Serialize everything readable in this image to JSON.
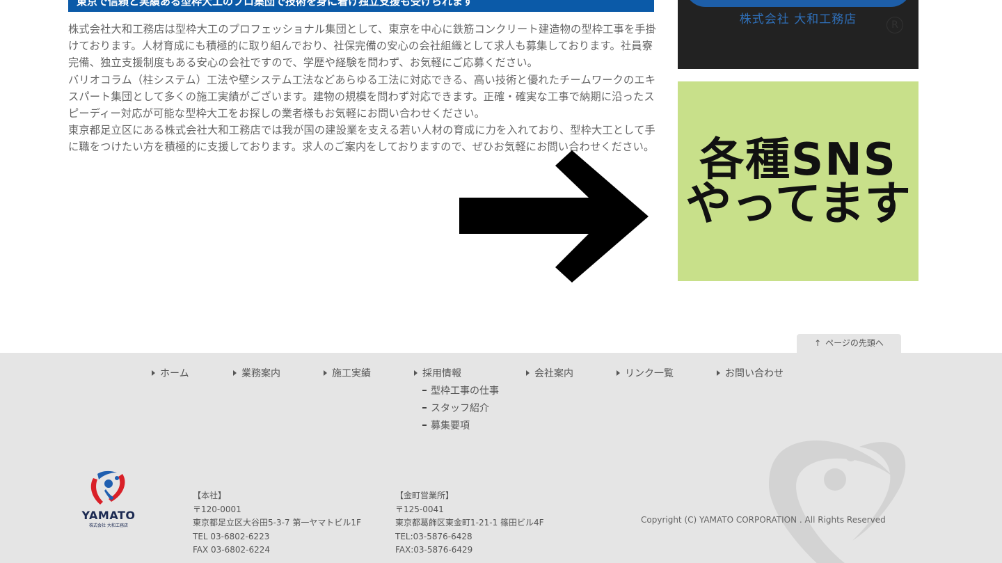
{
  "main": {
    "heading": "東京で信頼と実績ある型枠大工のプロ集団で技術を身に着け独立支援も受けられます",
    "paragraphs": [
      "株式会社大和工務店は型枠大工のプロフェッショナル集団として、東京を中心に鉄筋コンクリート建造物の型枠工事を手掛けております。人材育成にも積極的に取り組んでおり、社保完備の安心の会社組織として求人も募集しております。社員寮完備、独立支援制度もある安心の会社ですので、学歴や経験を問わず、お気軽にご応募ください。",
      "バリオコラム（柱システム）工法や壁システム工法などあらゆる工法に対応できる、高い技術と優れたチームワークのエキスパート集団として多くの施工実績がございます。建物の規模を問わず対応できます。正確・確実な工事で納期に沿ったスピーディー対応が可能な型枠大工をお探しの業者様もお気軽にお問い合わせください。",
      "東京都足立区にある株式会社大和工務店では我が国の建設業を支える若い人材の育成に力を入れており、型枠大工として手に職をつけたい方を積極的に支援しております。求人のご案内をしておりますので、ぜひお気軽にお問い合わせください。"
    ]
  },
  "side": {
    "logo_banner_text": "株式会社 大和工務店",
    "logo_banner_mark": "R",
    "sns_line1": "各種SNS",
    "sns_line2": "やってます"
  },
  "page_top": {
    "icon": "up-arrow-icon",
    "label": "ページの先頭へ"
  },
  "footer": {
    "nav": [
      "ホーム",
      "業務案内",
      "施工実績",
      "採用情報",
      "会社案内",
      "リンク一覧",
      "お問い合わせ"
    ],
    "recruit_sub": [
      "型枠工事の仕事",
      "スタッフ紹介",
      "募集要項"
    ],
    "brand": "YAMATO",
    "brand_sub": "株式会社 大和工務店",
    "head_office": {
      "label": "【本社】",
      "zip": "〒120-0001",
      "address": "東京都足立区大谷田5-3-7 第一ヤマトビル1F",
      "tel": "TEL 03-6802-6223",
      "fax": "FAX 03-6802-6224"
    },
    "branch_office": {
      "label": "【金町営業所】",
      "zip": "〒125-0041",
      "address": "東京都葛飾区東金町1-21-1 篠田ビル4F",
      "tel": "TEL:03-5876-6428",
      "fax": "FAX:03-5876-6429"
    },
    "copyright": "Copyright (C) YAMATO CORPORATION . All Rights Reserved"
  },
  "colors": {
    "accent_blue": "#0b5aa8",
    "sns_green": "#c8e08a",
    "footer_bg": "#e5e5e5"
  }
}
